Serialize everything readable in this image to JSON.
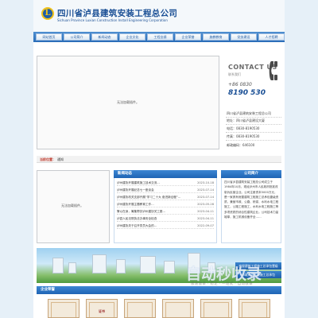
{
  "header": {
    "company_cn": "四川省泸县建筑安装工程总公司",
    "company_en": "Sichuan Province Luxian Construction Install Engineering Corporation",
    "logo_letter": "L"
  },
  "nav": {
    "items": [
      "网站首页",
      "公司简介",
      "新闻动态",
      "企业文化",
      "工程业绩",
      "企业荣誉",
      "施教教育",
      "党务建设",
      "人才招聘"
    ]
  },
  "banner": {
    "placeholder": "无法加载插件。"
  },
  "contact": {
    "title": "CONTACT US",
    "subtitle": "联系我们",
    "tel_prefix": "+86 0830",
    "tel_number": "8190 530",
    "company": "四川省泸县建筑安装工程总公司",
    "address": "地址：四川省泸县建设大厦",
    "phone": "电话：0830-8190530",
    "fax": "传真：0830-8190530",
    "postcode": "邮政编码：646100"
  },
  "breadcrumb": {
    "label": "当前位置：",
    "value": "通知"
  },
  "video": {
    "placeholder": "无法加载插件。"
  },
  "news": {
    "title": "新闻动态",
    "items": [
      {
        "title": "泸州建协开展建筑施工技术交流…",
        "date": "2023-10-18"
      },
      {
        "title": "泸州建协开展纪念七一座谈会",
        "date": "2023-07-14"
      },
      {
        "title": "泸州建协机关支部开展“学习二十大 奋进新征程”…",
        "date": "2023-07-14"
      },
      {
        "title": "泸州建协开展主题教育工作…",
        "date": "2023-05-28"
      },
      {
        "title": "警以在身，筹集帮扶泸州建协关工委…",
        "date": "2023-04-11"
      },
      {
        "title": "泸县人民法院执法办事安全检查",
        "date": "2023-04-11"
      },
      {
        "title": "泸州建协关于召开党员大会的…",
        "date": "2022-09-07"
      }
    ]
  },
  "intro": {
    "title": "公司简介",
    "text": "四川省泸县建筑安装工程总公司成立于1984年10月，现经泸州市人民政府批准改制为民营企业。公司注册资本5000万元，是一家具有房屋建筑工程施工总承包壹级资质，兼营市政、公路、桥梁、水利水电工程施工，公路工程施工，水利水电工程施工等多项资质的综合性建筑企业。公司技术力量雄厚，施工机械设备齐全……"
  },
  "city": {
    "buttons": [
      "房屋建筑工程施工总承包壹级",
      "市政公用工程施工总承包",
      "公路工程施工总承包"
    ]
  },
  "watermark": {
    "main": "自动秒收录",
    "sub": "极速收录 · 稳定 · 一站式 · 自动收录"
  },
  "honor": {
    "title": "企业荣誉",
    "cert_label": "证书"
  },
  "colors": {
    "brand_blue": "#1a4f95",
    "nav_blue": "#2a6db8",
    "logo_gold": "#f0c21b"
  }
}
